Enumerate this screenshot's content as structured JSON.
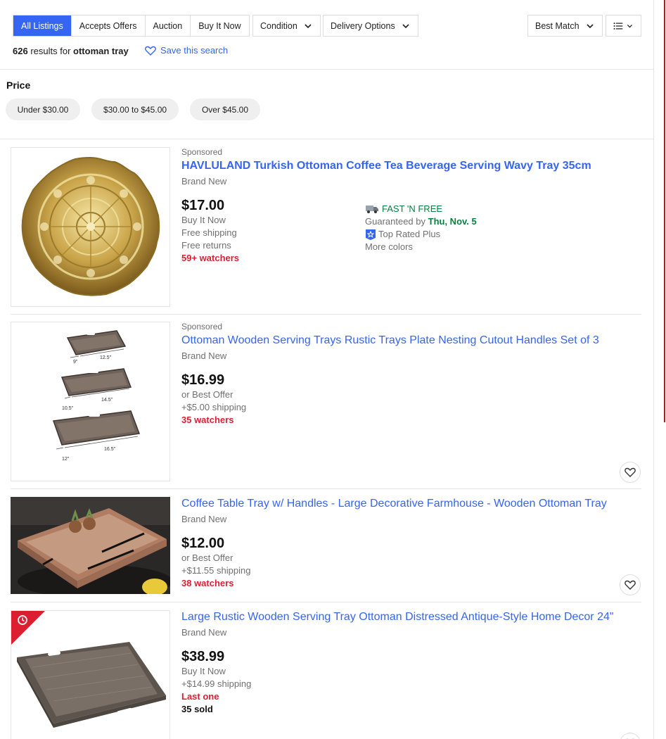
{
  "toolbar": {
    "tabs": [
      "All Listings",
      "Accepts Offers",
      "Auction",
      "Buy It Now"
    ],
    "condition_label": "Condition",
    "delivery_label": "Delivery Options",
    "sort_label": "Best Match"
  },
  "results": {
    "count": "626",
    "text": "results for",
    "query": "ottoman tray",
    "save_label": "Save this search"
  },
  "price_filter": {
    "title": "Price",
    "chips": [
      "Under $30.00",
      "$30.00 to $45.00",
      "Over $45.00"
    ]
  },
  "items": [
    {
      "sponsored": "Sponsored",
      "title": "HAVLULAND Turkish Ottoman Coffee Tea Beverage Serving Wavy Tray 35cm",
      "condition": "Brand New",
      "price": "$17.00",
      "lines": [
        "Buy It Now",
        "Free shipping",
        "Free returns"
      ],
      "watchers": "59+ watchers",
      "fast_label": "FAST 'N FREE",
      "guaranteed_prefix": "Guaranteed by",
      "guaranteed_date": "Thu, Nov. 5",
      "top_rated": "Top Rated Plus",
      "more_colors": "More colors"
    },
    {
      "sponsored": "Sponsored",
      "title": "Ottoman Wooden Serving Trays Rustic Trays Plate Nesting Cutout Handles Set of 3",
      "condition": "Brand New",
      "price": "$16.99",
      "lines": [
        "or Best Offer",
        "+$5.00 shipping"
      ],
      "watchers": "35 watchers",
      "dims": [
        "9\"",
        "12.5\"",
        "10.5\"",
        "14.5\"",
        "12\"",
        "16.5\""
      ]
    },
    {
      "title": "Coffee Table Tray w/ Handles - Large Decorative Farmhouse - Wooden Ottoman Tray",
      "condition": "Brand New",
      "price": "$12.00",
      "lines": [
        "or Best Offer",
        "+$11.55 shipping"
      ],
      "watchers": "38 watchers"
    },
    {
      "title": "Large Rustic Wooden Serving Tray Ottoman Distressed Antique-Style Home Decor 24\"",
      "condition": "Brand New",
      "price": "$38.99",
      "lines": [
        "Buy It Now",
        "+$14.99 shipping"
      ],
      "last_one": "Last one",
      "sold": "35 sold"
    }
  ],
  "colors": {
    "accent": "#3665f3",
    "watchers_red": "#dd1e31",
    "green": "#05823f"
  }
}
